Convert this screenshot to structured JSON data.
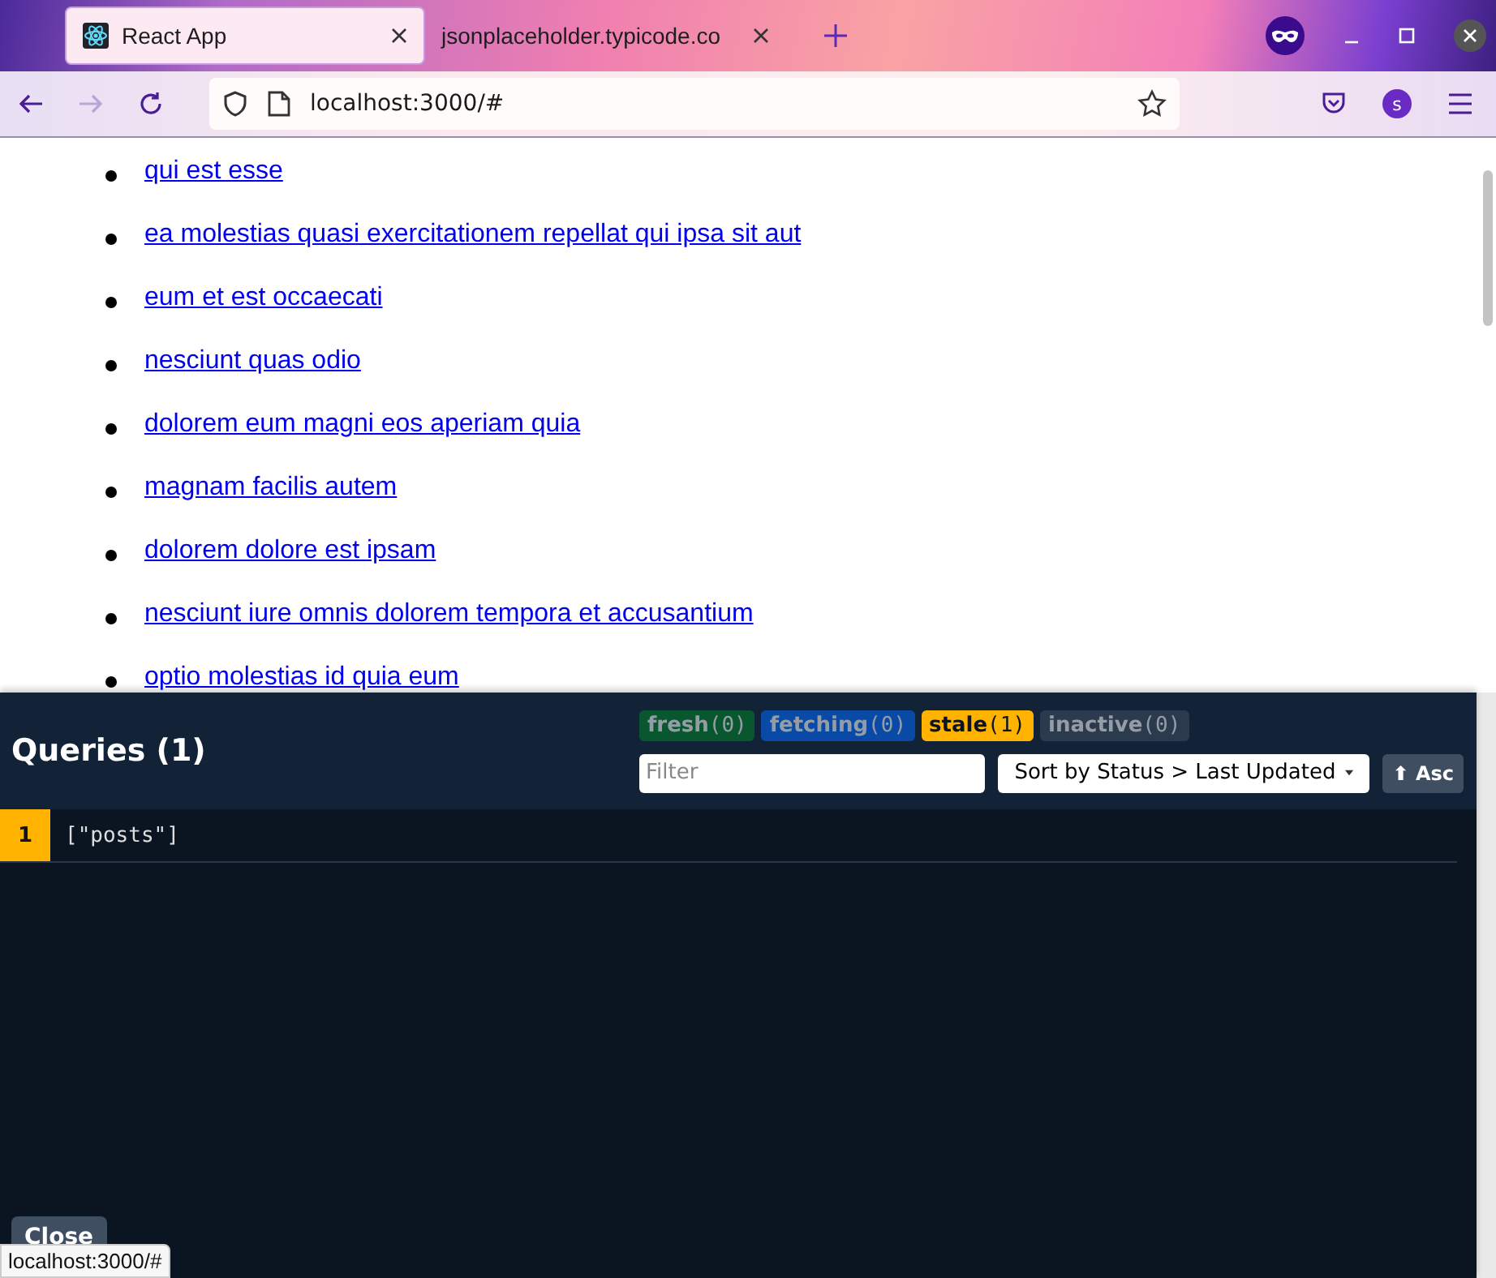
{
  "browser": {
    "tabs": [
      {
        "title": "React App",
        "selected": true
      },
      {
        "title": "jsonplaceholder.typicode.co",
        "selected": false
      }
    ],
    "nav": [
      {
        "kind": "back",
        "disabled": false
      },
      {
        "kind": "forward",
        "disabled": true
      },
      {
        "kind": "reload",
        "disabled": false
      }
    ],
    "address": "localhost:3000/#",
    "profile_initial": "s"
  },
  "posts": [
    "qui est esse",
    "ea molestias quasi exercitationem repellat qui ipsa sit aut",
    "eum et est occaecati",
    "nesciunt quas odio",
    "dolorem eum magni eos aperiam quia",
    "magnam facilis autem",
    "dolorem dolore est ipsam",
    "nesciunt iure omnis dolorem tempora et accusantium",
    "optio molestias id quia eum"
  ],
  "devtools": {
    "title": "Queries (1)",
    "status_counts": [
      {
        "kind": "fresh",
        "label": "fresh",
        "count": "(0)",
        "active": false
      },
      {
        "kind": "fetching",
        "label": "fetching",
        "count": "(0)",
        "active": false
      },
      {
        "kind": "stale",
        "label": "stale",
        "count": "(1)",
        "active": true
      },
      {
        "kind": "inactive",
        "label": "inactive",
        "count": "(0)",
        "active": false
      }
    ],
    "filter": {
      "placeholder": "Filter"
    },
    "sort": "Sort by Status > Last Updated",
    "order": {
      "icon": "⬆",
      "label": "Asc"
    },
    "queries": [
      {
        "color": "#ffb200",
        "observers": "1",
        "key": "[\"posts\"]"
      }
    ],
    "close": "Close"
  },
  "status_tooltip": "localhost:3000/#"
}
